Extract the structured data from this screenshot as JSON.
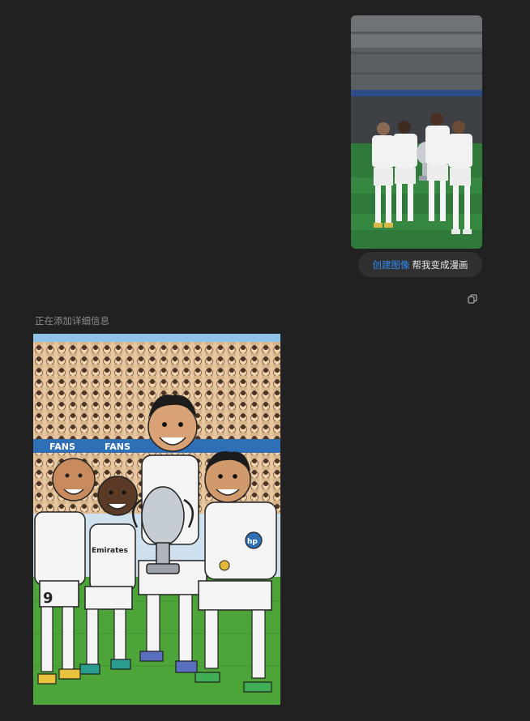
{
  "user_message": {
    "photo_icon": "photo-thumbnail",
    "prompt_tag": "创建图像",
    "prompt_text": "帮我变成漫画"
  },
  "assistant": {
    "copy_icon": "copy-icon",
    "status": "正在添加详细信息",
    "generated_image": {
      "banner_left": "FANS",
      "banner_right": "FANS",
      "jersey_sponsor": "Emirates",
      "jersey_number": "9",
      "badge_text": "hp"
    }
  },
  "colors": {
    "background": "#212121",
    "bubble": "#303030",
    "accent": "#2f8df5",
    "muted_text": "#8c8c8c"
  }
}
